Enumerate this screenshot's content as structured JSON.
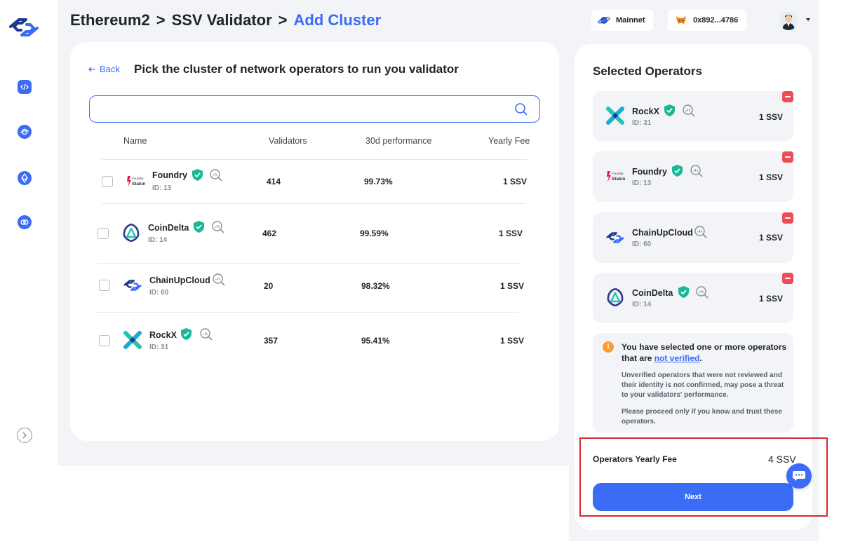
{
  "breadcrumb": {
    "items": [
      "Ethereum2",
      "SSV Validator",
      "Add Cluster"
    ],
    "separator": ">"
  },
  "header": {
    "network_label": "Mainnet",
    "wallet_address": "0x892...4786"
  },
  "picker": {
    "back_label": "Back",
    "title": "Pick the cluster of network operators to run you validator",
    "search_value": "",
    "columns": [
      "Name",
      "Validators",
      "30d performance",
      "Yearly Fee"
    ],
    "rows": [
      {
        "name": "Foundry",
        "id": "ID: 13",
        "validators": "414",
        "performance": "99.73%",
        "fee": "1 SSV",
        "logo": "foundry-logo"
      },
      {
        "name": "CoinDelta",
        "id": "ID: 14",
        "validators": "462",
        "performance": "99.59%",
        "fee": "1 SSV",
        "logo": "coindelta-logo"
      },
      {
        "name": "ChainUpCloud",
        "id": "ID: 60",
        "validators": "20",
        "performance": "98.32%",
        "fee": "1 SSV",
        "logo": "chainupcloud-logo"
      },
      {
        "name": "RockX",
        "id": "ID: 31",
        "validators": "357",
        "performance": "95.41%",
        "fee": "1 SSV",
        "logo": "rockx-logo"
      }
    ]
  },
  "selected": {
    "title": "Selected Operators",
    "operators": [
      {
        "name": "RockX",
        "id": "ID: 31",
        "fee": "1 SSV",
        "verified": true
      },
      {
        "name": "Foundry",
        "id": "ID: 13",
        "fee": "1 SSV",
        "verified": true
      },
      {
        "name": "ChainUpCloud",
        "id": "ID: 60",
        "fee": "1 SSV",
        "verified": false
      },
      {
        "name": "CoinDelta",
        "id": "ID: 14",
        "fee": "1 SSV",
        "verified": true
      }
    ],
    "warning": {
      "main_prefix": "You have selected one or more operators that are ",
      "link": "not verified",
      "main_suffix": ".",
      "detail": "Unverified operators that were not reviewed and their identity is not confirmed, may pose a threat to your validators' performance.",
      "advice": "Please proceed only if you know and trust these operators."
    },
    "fee_label": "Operators Yearly Fee",
    "fee_total": "4 SSV",
    "next_label": "Next"
  },
  "colors": {
    "accent": "#3b6cf6",
    "verified": "#16b896",
    "remove": "#ec4c56",
    "warning": "#ff9a2e",
    "highlight_box": "#d9262e"
  }
}
